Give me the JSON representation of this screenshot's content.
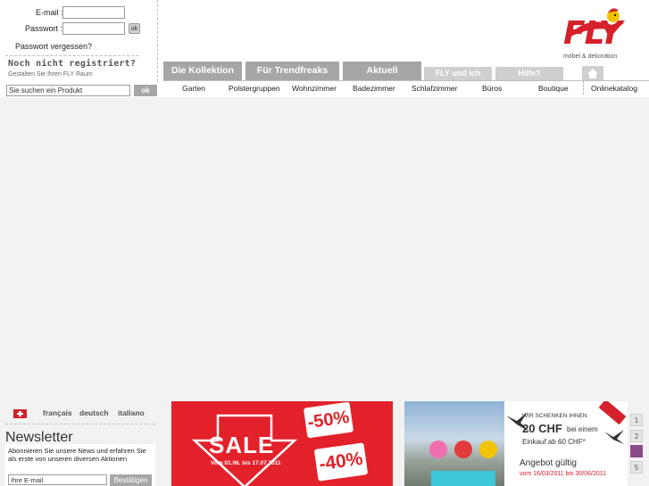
{
  "login": {
    "email_label": "E-mail :",
    "password_label": "Passwort :",
    "ok_label": "ok",
    "forgot_password": "Passwort vergessen?",
    "register_title": "Noch nicht registriert?",
    "register_subtitle": "Gestalten Sie Ihren FLY Raum"
  },
  "search": {
    "placeholder": "Sie suchen ein Produkt",
    "ok_label": "ok"
  },
  "brand": {
    "logo_text": "FLY",
    "tagline": "möbel & dekoration",
    "color": "#d6202a"
  },
  "tabs": [
    {
      "label": "Die Kollektion"
    },
    {
      "label": "Für Trendfreaks"
    },
    {
      "label": "Aktuell"
    },
    {
      "label": "FLY und ich"
    },
    {
      "label": "Hilfe?"
    }
  ],
  "home_icon": "home-icon",
  "subnav": [
    "Garten",
    "Polstergruppen",
    "Wohnzimmer",
    "Badezimmer",
    "Schlafzimmer",
    "Büros",
    "Boutique",
    "Onlinekatalog"
  ],
  "footer": {
    "country_flag": "swiss-flag-icon",
    "languages": [
      "français",
      "deutsch",
      "italiano"
    ],
    "newsletter_title": "Newsletter",
    "newsletter_text": "Abonnieren Sie unsere News und erfahren Sie als erste von unseren diversen Aktionen",
    "email_placeholder": "Ihre E-mail",
    "confirm_label": "Bestätigen"
  },
  "promo_sale": {
    "title": "SALE",
    "dates": "Vom 01.06. bis 17.07.2011",
    "tag1": "-50%",
    "tag2": "-40%"
  },
  "promo_gift": {
    "heading": "WIR SCHENKEN IHNEN",
    "amount": "20 CHF",
    "amount_suffix": "bei einem",
    "line2": "Einkauf ab 60 CHF*",
    "valid_label": "Angebot gültig",
    "valid_dates": "vom 16/03/2011 bis 30/06/2011"
  },
  "pager": [
    "1",
    "2",
    "",
    "5"
  ]
}
